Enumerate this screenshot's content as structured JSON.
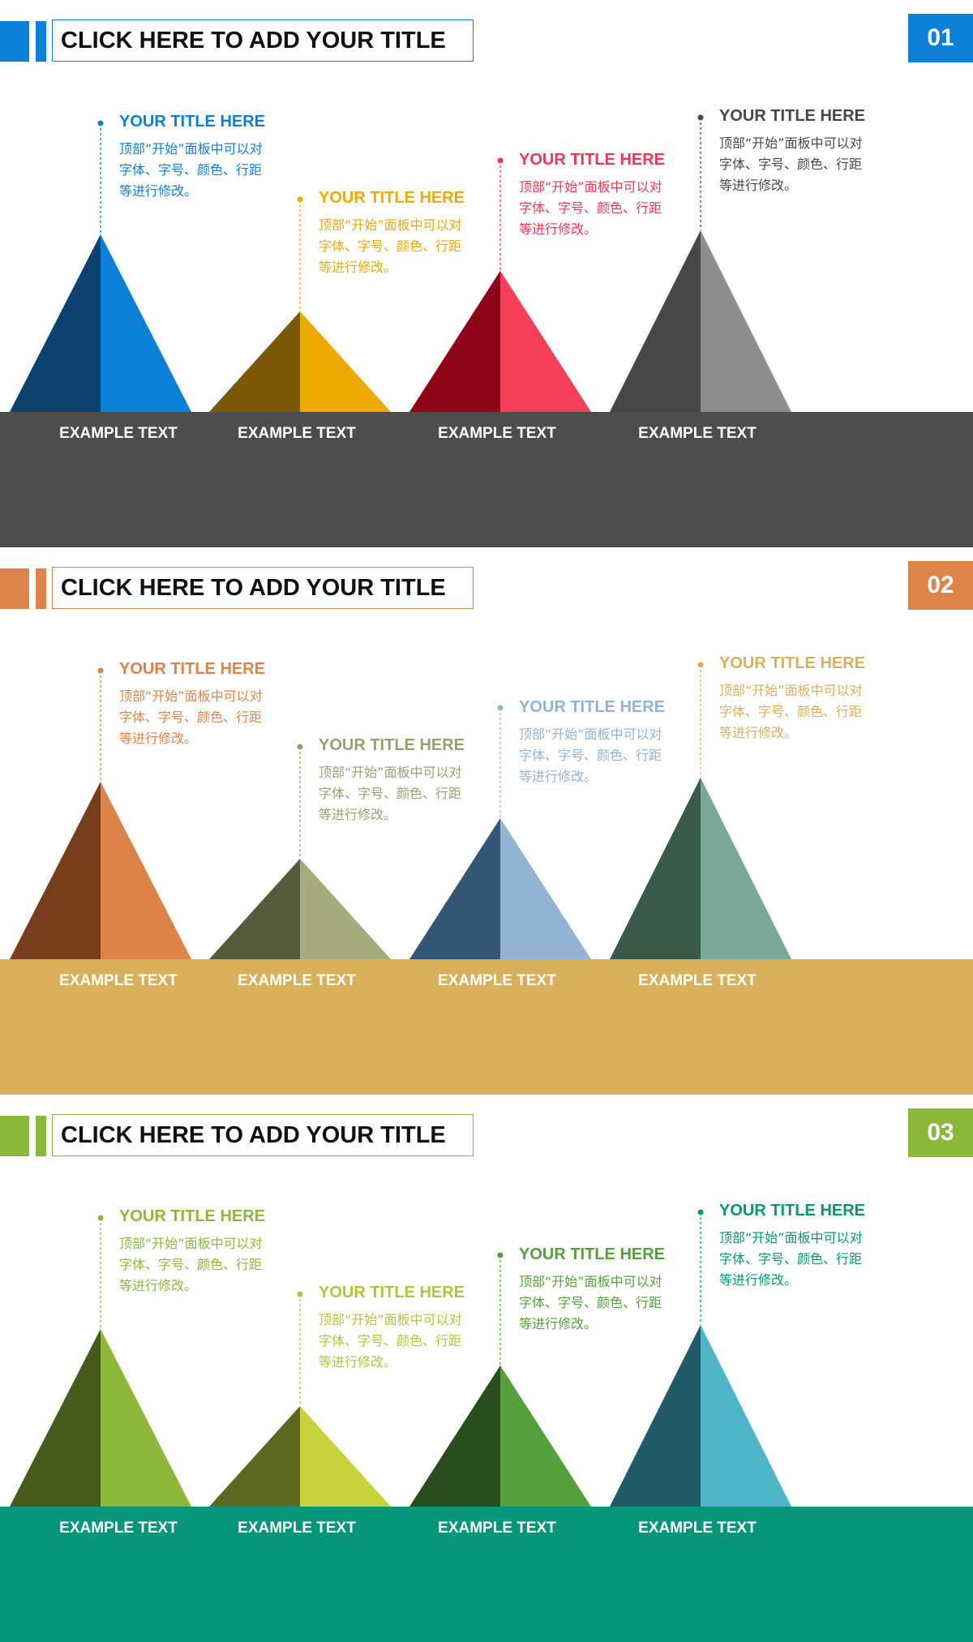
{
  "slides": [
    {
      "number": "01",
      "title": "CLICK HERE TO ADD YOUR TITLE",
      "accent": "#0b80d6",
      "base_color": "#4d4d4d",
      "items": [
        {
          "title": "YOUR TITLE HERE",
          "desc": "顶部“开始”面板中可以对字体、字号、颜色、行距等进行修改。",
          "label": "EXAMPLE TEXT",
          "dark": "#0d416e",
          "light": "#0b80d6",
          "text_color": "#0b80d6"
        },
        {
          "title": "YOUR TITLE HERE",
          "desc": "顶部“开始”面板中可以对字体、字号、颜色、行距等进行修改。",
          "label": "EXAMPLE TEXT",
          "dark": "#7a5806",
          "light": "#eeaa00",
          "text_color": "#eeaa00"
        },
        {
          "title": "YOUR TITLE HERE",
          "desc": "顶部“开始”面板中可以对字体、字号、颜色、行距等进行修改。",
          "label": "EXAMPLE TEXT",
          "dark": "#8f0418",
          "light": "#f53e58",
          "text_color": "#ee3657"
        },
        {
          "title": "YOUR TITLE HERE",
          "desc": "顶部“开始”面板中可以对字体、字号、颜色、行距等进行修改。",
          "label": "EXAMPLE TEXT",
          "dark": "#474747",
          "light": "#8e8e8e",
          "text_color": "#474747"
        }
      ]
    },
    {
      "number": "02",
      "title": "CLICK HERE TO ADD YOUR TITLE",
      "accent": "#de834a",
      "base_color": "#d8b05c",
      "items": [
        {
          "title": "YOUR TITLE HERE",
          "desc": "顶部“开始”面板中可以对字体、字号、颜色、行距等进行修改。",
          "label": "EXAMPLE TEXT",
          "dark": "#783d1a",
          "light": "#dc834a",
          "text_color": "#dc834a"
        },
        {
          "title": "YOUR TITLE HERE",
          "desc": "顶部“开始”面板中可以对字体、字号、颜色、行距等进行修改。",
          "label": "EXAMPLE TEXT",
          "dark": "#555a3b",
          "light": "#a5ab7d",
          "text_color": "#9a9f72"
        },
        {
          "title": "YOUR TITLE HERE",
          "desc": "顶部“开始”面板中可以对字体、字号、颜色、行距等进行修改。",
          "label": "EXAMPLE TEXT",
          "dark": "#345775",
          "light": "#93b3d2",
          "text_color": "#93b3d2"
        },
        {
          "title": "YOUR TITLE HERE",
          "desc": "顶部“开始”面板中可以对字体、字号、颜色、行距等进行修改。",
          "label": "EXAMPLE TEXT",
          "dark": "#3a5a4b",
          "light": "#7aa898",
          "text_color": "#d8b05c"
        }
      ]
    },
    {
      "number": "03",
      "title": "CLICK HERE TO ADD YOUR TITLE",
      "accent": "#8bb83a",
      "base_color": "#07967a",
      "items": [
        {
          "title": "YOUR TITLE HERE",
          "desc": "顶部“开始”面板中可以对字体、字号、颜色、行距等进行修改。",
          "label": "EXAMPLE TEXT",
          "dark": "#465b1c",
          "light": "#8db83a",
          "text_color": "#8db83a"
        },
        {
          "title": "YOUR TITLE HERE",
          "desc": "顶部“开始”面板中可以对字体、字号、颜色、行距等进行修改。",
          "label": "EXAMPLE TEXT",
          "dark": "#5c6820",
          "light": "#c7d23d",
          "text_color": "#b4c43a"
        },
        {
          "title": "YOUR TITLE HERE",
          "desc": "顶部“开始”面板中可以对字体、字号、颜色、行距等进行修改。",
          "label": "EXAMPLE TEXT",
          "dark": "#294e1d",
          "light": "#53a03c",
          "text_color": "#53a03c"
        },
        {
          "title": "YOUR TITLE HERE",
          "desc": "顶部“开始”面板中可以对字体、字号、颜色、行距等进行修改。",
          "label": "EXAMPLE TEXT",
          "dark": "#1f5a66",
          "light": "#4eb5c8",
          "text_color": "#079672"
        }
      ]
    }
  ]
}
